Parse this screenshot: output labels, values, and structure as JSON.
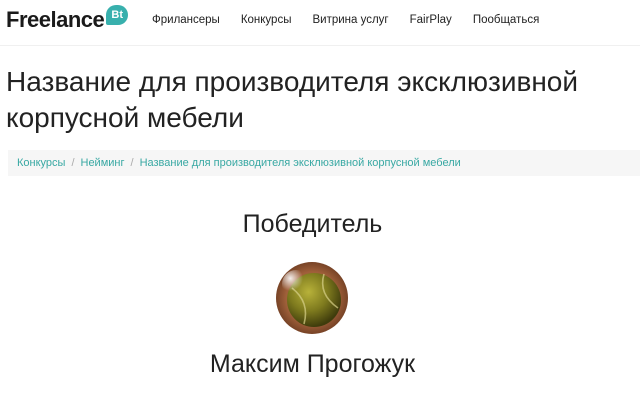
{
  "header": {
    "logo_text": "Freelance",
    "logo_badge": "Bt",
    "nav": [
      {
        "label": "Фрилансеры"
      },
      {
        "label": "Конкурсы"
      },
      {
        "label": "Витрина услуг"
      },
      {
        "label": "FairPlay"
      },
      {
        "label": "Пообщаться"
      }
    ]
  },
  "page": {
    "title": "Название для производителя эксклюзивной корпусной мебели"
  },
  "breadcrumb": {
    "items": [
      {
        "label": "Конкурсы"
      },
      {
        "label": "Нейминг"
      },
      {
        "label": "Название для производителя эксклюзивной корпусной мебели"
      }
    ],
    "separator": "/"
  },
  "winner": {
    "heading": "Победитель",
    "name": "Максим Прогожук"
  },
  "colors": {
    "accent": "#38b0ad",
    "link": "#38a8a3",
    "text": "#222222"
  }
}
